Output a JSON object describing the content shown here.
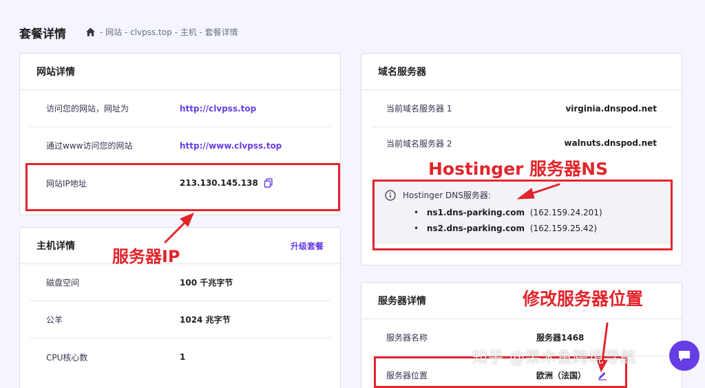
{
  "header": {
    "title": "套餐详情",
    "breadcrumb": "- 网站 - clvpss.top - 主机 - 套餐详情"
  },
  "website_card": {
    "title": "网站详情",
    "rows": [
      {
        "label": "访问您的网站，网址为",
        "value": "http://clvpss.top"
      },
      {
        "label": "通过www访问您的网站",
        "value": "http://www.clvpss.top"
      },
      {
        "label": "网站IP地址",
        "value": "213.130.145.138"
      }
    ]
  },
  "hosting_card": {
    "title": "主机详情",
    "upgrade_label": "升级套餐",
    "rows": [
      {
        "label": "磁盘空间",
        "value": "100 千兆字节"
      },
      {
        "label": "公羊",
        "value": "1024 兆字节"
      },
      {
        "label": "CPU核心数",
        "value": "1"
      }
    ]
  },
  "nameserver_card": {
    "title": "域名服务器",
    "rows": [
      {
        "label": "当前域名服务器 1",
        "value": "virginia.dnspod.net"
      },
      {
        "label": "当前域名服务器 2",
        "value": "walnuts.dnspod.net"
      }
    ],
    "dns_box": {
      "heading": "Hostinger DNS服务器:",
      "items": [
        {
          "name": "ns1.dns-parking.com",
          "ip": "(162.159.24.201)"
        },
        {
          "name": "ns2.dns-parking.com",
          "ip": "(162.159.25.42)"
        }
      ]
    }
  },
  "server_card": {
    "title": "服务器详情",
    "rows": [
      {
        "label": "服务器名称",
        "value": "服务器1468"
      },
      {
        "label": "服务器位置",
        "value": "欧洲（法国）"
      }
    ]
  },
  "annotations": {
    "server_ip": "服务器IP",
    "hostinger_ns": "Hostinger 服务器NS",
    "change_location": "修改服务器位置"
  },
  "watermark": "知乎 @果木鱼跨境导航",
  "colors": {
    "accent": "#673de6",
    "annotation_red": "#e3242b"
  }
}
